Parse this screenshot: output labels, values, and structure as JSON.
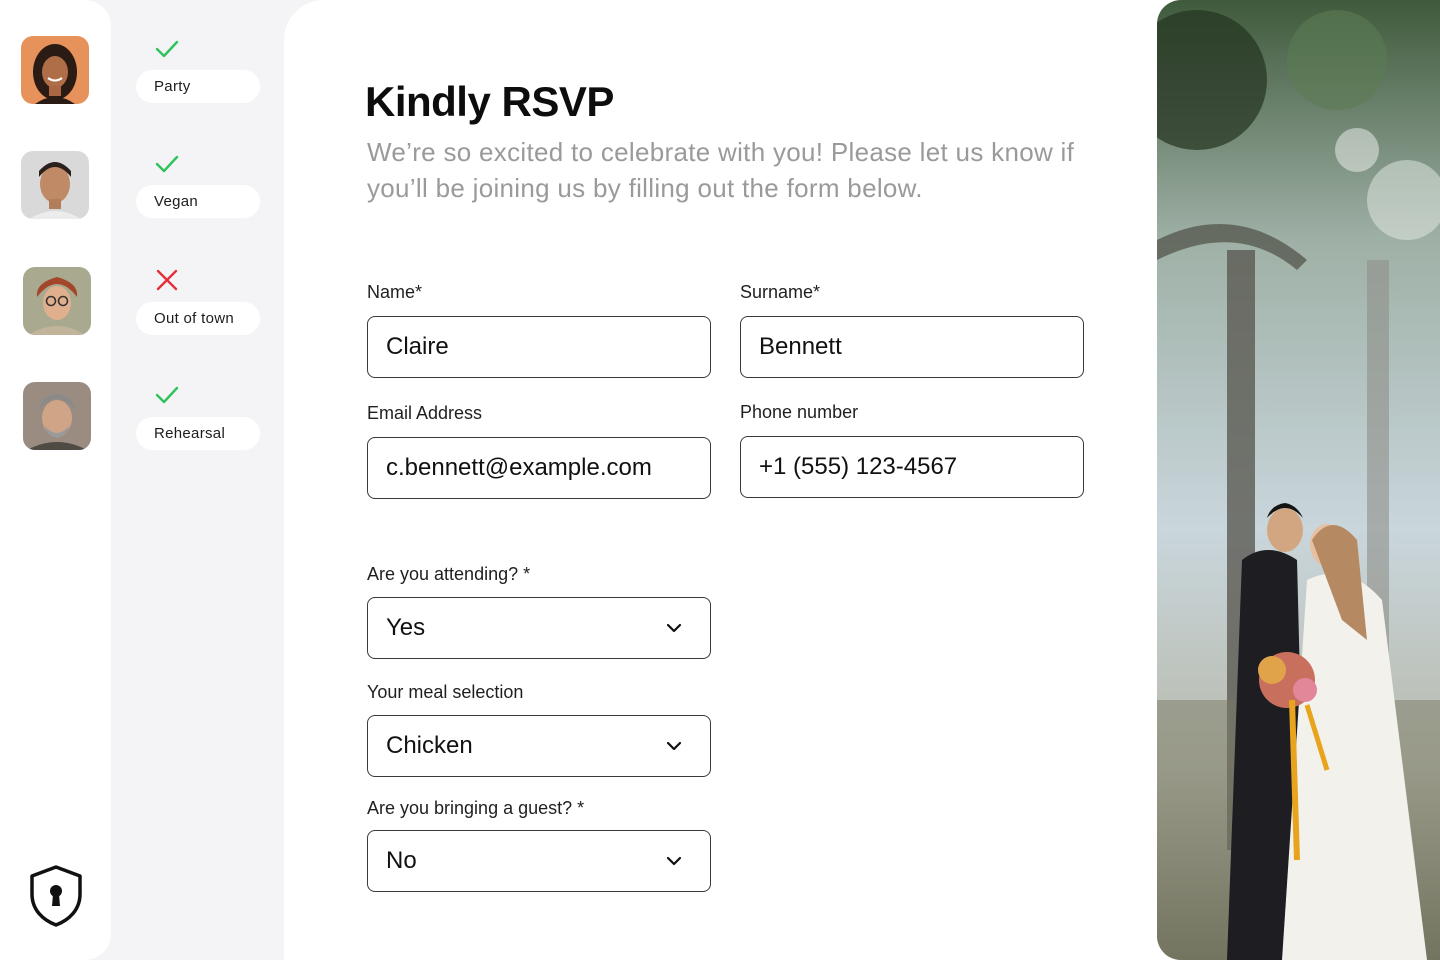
{
  "guests": [
    {
      "name": "guest-1",
      "status_label": "Party",
      "status": "check"
    },
    {
      "name": "guest-2",
      "status_label": "Vegan",
      "status": "check"
    },
    {
      "name": "guest-3",
      "status_label": "Out of town",
      "status": "cross"
    },
    {
      "name": "guest-4",
      "status_label": "Rehearsal",
      "status": "check"
    }
  ],
  "colors": {
    "check": "#2fc25b",
    "cross": "#e5303a",
    "field_border": "#3a3a3a",
    "subtitle": "#9a9a9a"
  },
  "form": {
    "title": "Kindly RSVP",
    "subtitle": "We’re so excited to celebrate with you! Please let us know if you’ll be joining us by filling out the form below.",
    "name_label": "Name*",
    "name_value": "Claire",
    "surname_label": "Surname*",
    "surname_value": "Bennett",
    "email_label": "Email Address",
    "email_value": "c.bennett@example.com",
    "phone_label": "Phone number",
    "phone_value": "+1 (555) 123-4567",
    "attending_label": "Are you attending? *",
    "attending_value": "Yes",
    "meal_label": "Your meal selection",
    "meal_value": "Chicken",
    "guest_label": "Are you bringing a guest? *",
    "guest_value": "No"
  },
  "icons": {
    "security": "shield-lock-icon",
    "dropdown": "chevron-down-icon",
    "check": "check-icon",
    "cross": "x-icon"
  }
}
